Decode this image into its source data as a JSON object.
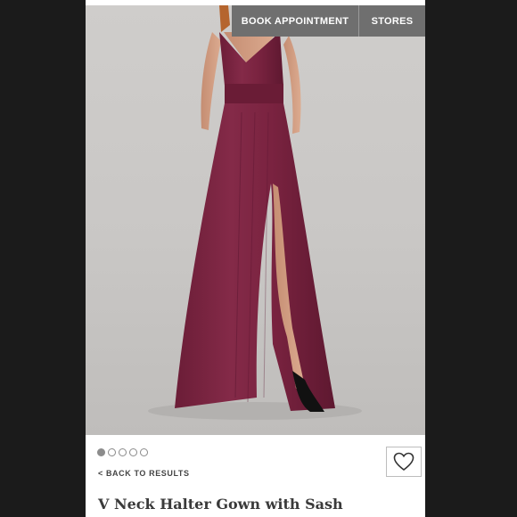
{
  "header": {
    "book_label": "BOOK APPOINTMENT",
    "stores_label": "STORES"
  },
  "gallery": {
    "image_count": 5,
    "active_index": 0
  },
  "nav": {
    "back_label": "< BACK TO RESULTS"
  },
  "product": {
    "title": "V Neck Halter Gown with Sash",
    "dress_color": "#7a2340"
  },
  "icons": {
    "favorite": "heart-outline-icon"
  }
}
